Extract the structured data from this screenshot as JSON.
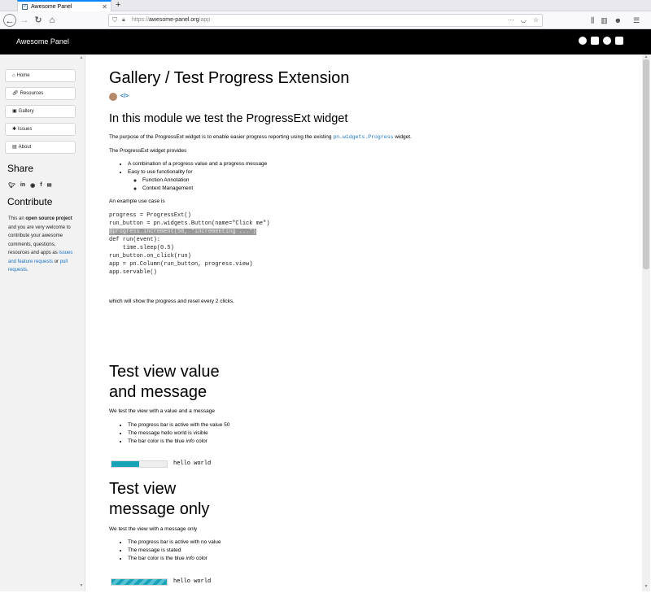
{
  "browser": {
    "tab_title": "Awesome Panel",
    "url_scheme": "https://",
    "url_host": "awesome-panel.org",
    "url_path": "/app"
  },
  "header": {
    "title": "Awesome Panel"
  },
  "sidebar": {
    "items": [
      {
        "label": "Home",
        "icon": "home-icon"
      },
      {
        "label": "Resources",
        "icon": "link-icon"
      },
      {
        "label": "Gallery",
        "icon": "gallery-icon"
      },
      {
        "label": "Issues",
        "icon": "bug-icon"
      },
      {
        "label": "About",
        "icon": "id-card-icon"
      }
    ],
    "share_heading": "Share",
    "contribute_heading": "Contribute",
    "contribute": {
      "p1": "This an ",
      "bold": "open source project",
      "p2": " and you are very welcome to contribute your awesome comments, questions, resources and apps as ",
      "link1": "issues and feature requests",
      "p3": " or ",
      "link2": "pull requests",
      "p4": "."
    }
  },
  "main": {
    "title": "Gallery / Test Progress Extension",
    "module_heading": "In this module we test the ProgressExt widget",
    "purpose_pre": "The purpose of the ProgressExt widget is to enable easier progress reporting using the existing ",
    "purpose_code": "pn.widgets.Progress",
    "purpose_post": " widget.",
    "provides": "The ProgressExt widget provides",
    "features": [
      "A combination of a progress value and a progress message",
      "Easy to use functionality for"
    ],
    "subfeatures": [
      "Function Annotation",
      "Context Management"
    ],
    "example_intro": "An example use case is",
    "code_lines": [
      "progress = ProgressExt()",
      "run_button = pn.widgets.Button(name=\"Click me\")",
      "",
      "@progress.increment(50, \"incrementing ...\")",
      "def run(event):",
      "    time.sleep(0.5)",
      "run_button.on_click(run)",
      "",
      "app = pn.Column(run_button, progress.view)",
      "app.servable()"
    ],
    "example_outro": "which will show the progress and reset every 2 clicks.",
    "section1": {
      "title_line1": "Test view value",
      "title_line2": "and message",
      "intro": "We test the view with a value and a message",
      "items": [
        "The progress bar is active with the value 50",
        "The message hello world is visible"
      ],
      "color_pre": "The bar color is the blue ",
      "color_em": "info",
      "color_post": " color",
      "progress_value": 50,
      "message": "hello world"
    },
    "section2": {
      "title_line1": "Test view",
      "title_line2": "message only",
      "intro": "We test the view with a message only",
      "items": [
        "The progress bar is active with no value",
        "The message is stated"
      ],
      "color_pre": "The bar color is the blue ",
      "color_em": "info",
      "color_post": " color",
      "message": "hello world"
    }
  },
  "colors": {
    "info": "#17a2b8",
    "link": "#1a73c4",
    "header_bg": "#000000"
  }
}
